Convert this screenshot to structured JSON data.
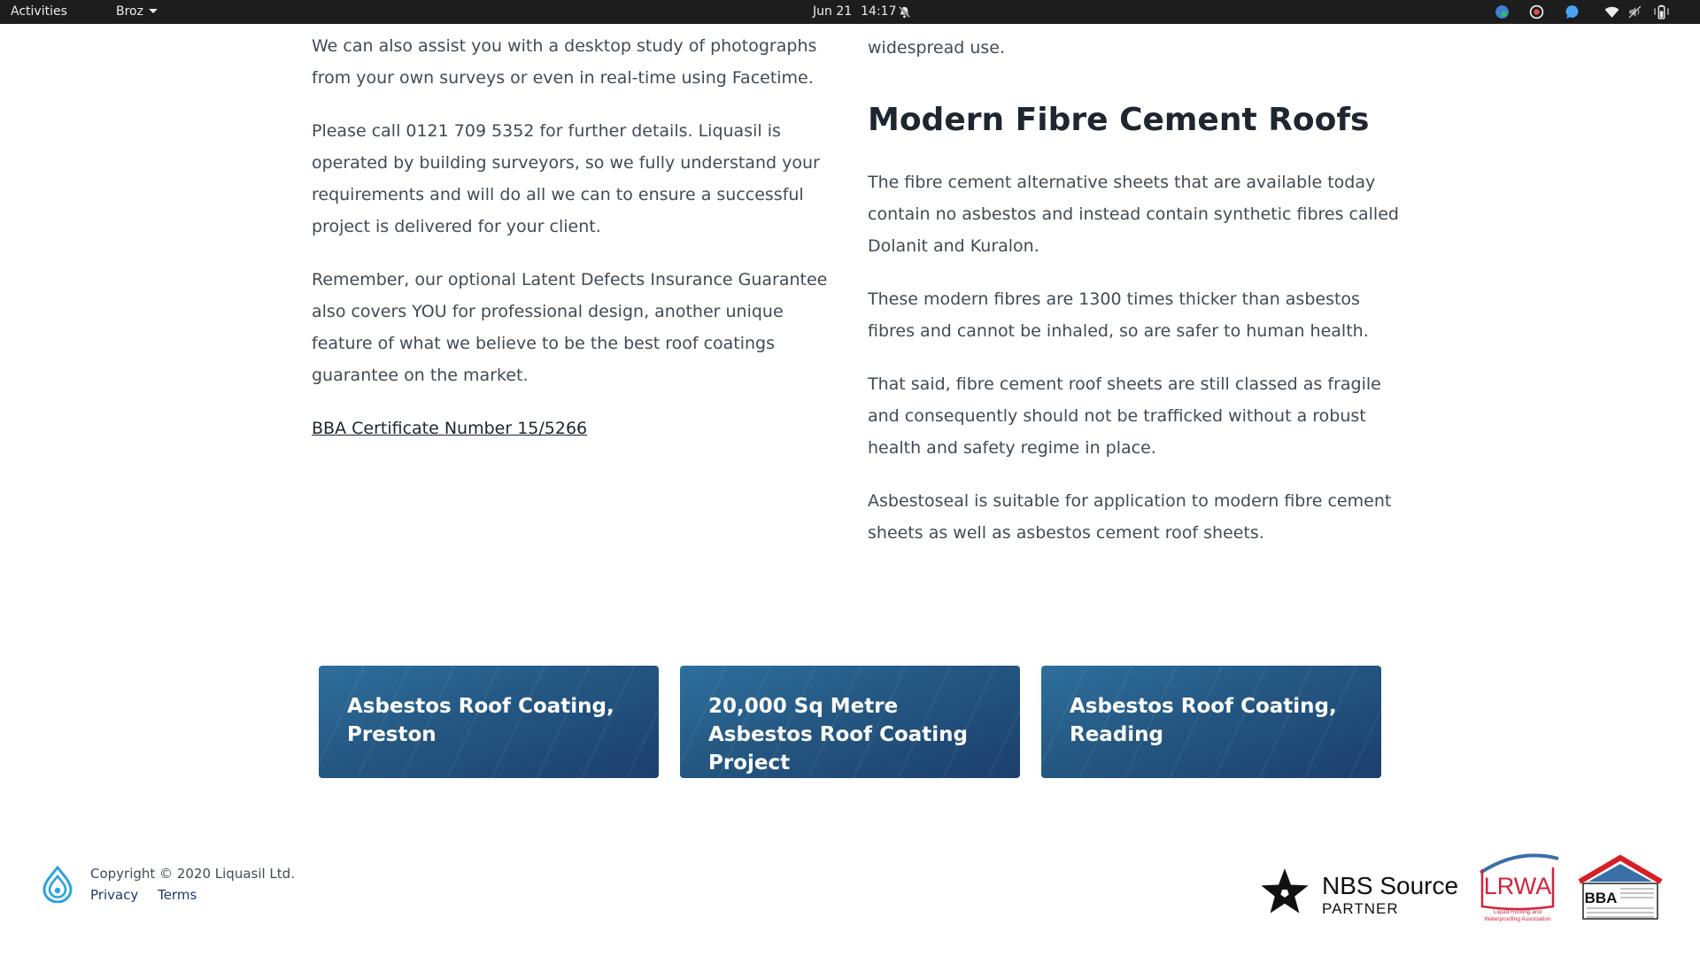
{
  "topbar": {
    "activities": "Activities",
    "app_menu": "Broz",
    "date": "Jun 21",
    "time": "14:17",
    "tray_icons": [
      "color-picker-icon",
      "record-icon",
      "chat-icon",
      "wifi-icon",
      "volume-icon",
      "battery-icon"
    ]
  },
  "left_column": {
    "paragraphs": [
      "We can also assist you with a desktop study of photographs from your own surveys or even in real-time using Facetime.",
      "Please call 0121 709 5352 for further details. Liquasil is operated by building surveyors, so we fully understand your requirements and will do all we can to ensure a successful project is delivered for your client.",
      "Remember, our optional Latent Defects Insurance Guarantee also covers YOU for professional design, another unique feature of what we believe to be the best roof coatings guarantee on the market."
    ],
    "certificate_link": "BBA Certificate Number 15/5266"
  },
  "right_column": {
    "lead_text": "widespread use.",
    "heading": "Modern Fibre Cement Roofs",
    "paragraphs": [
      "The fibre cement alternative sheets that are available today contain no asbestos and instead contain synthetic fibres called Dolanit and Kuralon.",
      "These modern fibres are 1300 times thicker than asbestos fibres and cannot be inhaled, so are safer to human health.",
      "That said, fibre cement roof sheets are still classed as fragile and consequently should not be trafficked without a robust health and safety regime in place.",
      "Asbestoseal is suitable for application to modern fibre cement sheets as well as asbestos cement roof sheets."
    ]
  },
  "project_cards": [
    {
      "title": "Asbestos Roof Coating, Preston"
    },
    {
      "title": "20,000 Sq Metre Asbestos Roof Coating Project"
    },
    {
      "title": "Asbestos Roof Coating, Reading"
    }
  ],
  "footer": {
    "copyright": "Copyright © 2020 Liquasil Ltd.",
    "links": [
      "Privacy",
      "Terms"
    ],
    "partner_logos": {
      "nbs_name": "NBS Source",
      "nbs_sub": "PARTNER",
      "lrwa_name": "LRWA",
      "lrwa_sub_1": "Liquid Roofing and",
      "lrwa_sub_2": "Waterproofing Association",
      "bba_name": "BBA"
    }
  },
  "colors": {
    "topbar_bg": "#1d1d1d",
    "body_text": "#414b55",
    "heading_text": "#1e2630",
    "card_blue": "#245782",
    "footer_link": "#1e3a6b",
    "logo_blue": "#2aa3dd",
    "lrwa_red": "#d2233c",
    "bba_red": "#d61f26"
  }
}
